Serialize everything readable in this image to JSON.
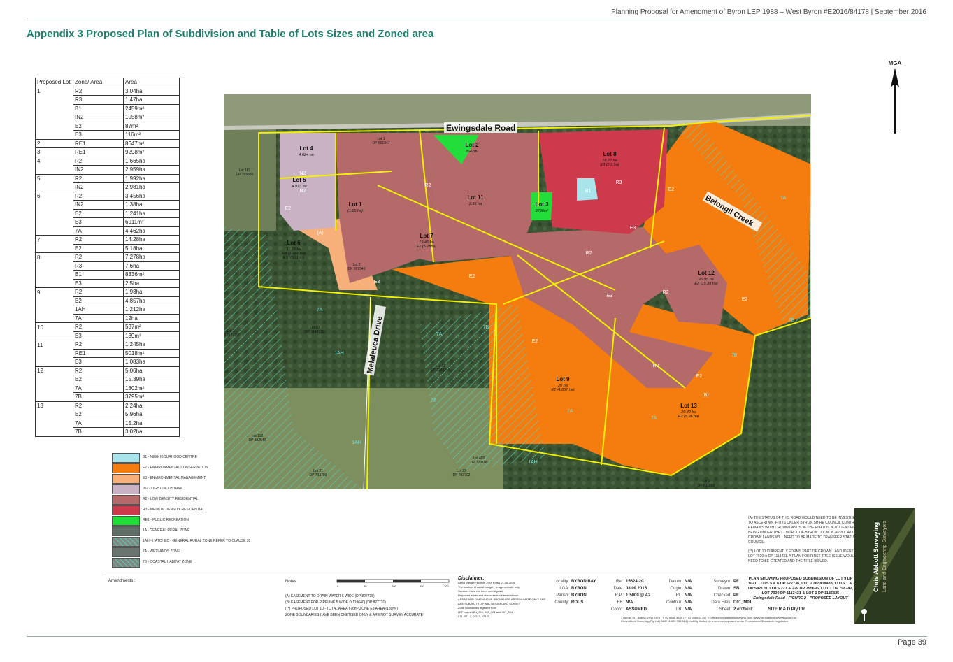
{
  "header": {
    "doc_title": "Planning Proposal for Amendment of Byron LEP 1988 – West Byron #E2016/84178 | September  2016",
    "appendix_title": "Appendix 3 Proposed Plan of Subdivision and Table of Lots Sizes and Zoned area"
  },
  "table": {
    "headers": [
      "Proposed Lot",
      "Zone/ Area",
      "Area"
    ],
    "groups": [
      {
        "lot": "1",
        "rows": [
          [
            "R2",
            "3.04ha"
          ],
          [
            "R3",
            "1.47ha"
          ],
          [
            "B1",
            "2459m²"
          ],
          [
            "IN2",
            "1058m²"
          ],
          [
            "E2",
            "87m²"
          ],
          [
            "E3",
            "116m²"
          ]
        ]
      },
      {
        "lot": "2",
        "rows": [
          [
            "RE1",
            "8647m²"
          ]
        ]
      },
      {
        "lot": "3",
        "rows": [
          [
            "RE1",
            "9298m²"
          ]
        ]
      },
      {
        "lot": "4",
        "rows": [
          [
            "R2",
            "1.665ha"
          ],
          [
            "IN2",
            "2.959ha"
          ]
        ]
      },
      {
        "lot": "5",
        "rows": [
          [
            "R2",
            "1.992ha"
          ],
          [
            "IN2",
            "2.981ha"
          ]
        ]
      },
      {
        "lot": "6",
        "rows": [
          [
            "R2",
            "3.456ha"
          ],
          [
            "IN2",
            "1.38ha"
          ],
          [
            "E2",
            "1.241ha"
          ],
          [
            "E3",
            "6911m²"
          ],
          [
            "7A",
            "4.462ha"
          ]
        ]
      },
      {
        "lot": "7",
        "rows": [
          [
            "R2",
            "14.28ha"
          ],
          [
            "E2",
            "5.18ha"
          ]
        ]
      },
      {
        "lot": "8",
        "rows": [
          [
            "R2",
            "7.278ha"
          ],
          [
            "R3",
            "7.6ha"
          ],
          [
            "B1",
            "8336m²"
          ],
          [
            "E3",
            "2.5ha"
          ]
        ]
      },
      {
        "lot": "9",
        "rows": [
          [
            "R2",
            "1.93ha"
          ],
          [
            "E2",
            "4.857ha"
          ],
          [
            "1AH",
            "1.212ha"
          ],
          [
            "7A",
            "12ha"
          ]
        ]
      },
      {
        "lot": "10",
        "rows": [
          [
            "R2",
            "537m²"
          ],
          [
            "E3",
            "139m²"
          ]
        ]
      },
      {
        "lot": "11",
        "rows": [
          [
            "R2",
            "1.245ha"
          ],
          [
            "RE1",
            "5018m²"
          ],
          [
            "E3",
            "1.083ha"
          ]
        ]
      },
      {
        "lot": "12",
        "rows": [
          [
            "R2",
            "5.06ha"
          ],
          [
            "E2",
            "15.39ha"
          ],
          [
            "7A",
            "1802m²"
          ],
          [
            "7B",
            "3795m²"
          ]
        ]
      },
      {
        "lot": "13",
        "rows": [
          [
            "R2",
            "2.24ha"
          ],
          [
            "E2",
            "5.96ha"
          ],
          [
            "7A",
            "15.2ha"
          ],
          [
            "7B",
            "3.02ha"
          ]
        ]
      }
    ]
  },
  "map": {
    "roads": {
      "ewingsdale": "Ewingsdale Road",
      "melaleuca": "Melaleuca Drive",
      "belongil": "Belongil Creek"
    },
    "north_label": "MGA",
    "colors": {
      "b1": "#a8e4ea",
      "e2": "#f57d10",
      "e3": "#f7b07a",
      "in2": "#c9b2c4",
      "r2": "#b56a6a",
      "r3": "#cc3a4c",
      "re1": "#22dd3a",
      "bush": "#3e5a36",
      "field": "#8a9a68",
      "boundary": "#f3f000"
    },
    "lots": [
      {
        "name": "Lot 4",
        "area": "4.624 ha"
      },
      {
        "name": "Lot 5",
        "area": "4.973 ha"
      },
      {
        "name": "Lot 6",
        "area": "11.23 ha",
        "sub1": "E2 (1.241 ha)",
        "sub2": "E3 (6911m²)"
      },
      {
        "name": "Lot 2",
        "area": "8647m²"
      },
      {
        "name": "Lot 7",
        "area": "19.46 ha",
        "sub1": "E2 (5.18ha)"
      },
      {
        "name": "Lot 3",
        "area": "9298m²"
      },
      {
        "name": "Lot 8",
        "area": "18.27 ha",
        "sub1": "E3 (2.5 ha)"
      },
      {
        "name": "Lot 12",
        "area": "20.95 ha",
        "sub1": "E2 (15.39 ha)"
      },
      {
        "name": "Lot 9",
        "area": "20 ha",
        "sub1": "E2 (4.857 ha)"
      },
      {
        "name": "Lot 13",
        "area": "20.42 ha",
        "sub1": "E2 (5.96 ha)"
      },
      {
        "name": "Lot 1",
        "area": "(1.65 ha)"
      },
      {
        "name": "Lot 11",
        "area": "2.33 ha"
      }
    ],
    "zones": [
      "IN2",
      "IN2",
      "E2",
      "E2",
      "E2",
      "E2",
      "E2",
      "E2",
      "E3",
      "E3",
      "E3",
      "R2",
      "R2",
      "R2",
      "R2",
      "R3",
      "B1",
      "7A",
      "7A",
      "7A",
      "7A",
      "7A",
      "7A",
      "7B",
      "7B",
      "7B",
      "1AH",
      "1AH",
      "1AH",
      "(A)",
      "(B)"
    ],
    "existing_lots": [
      {
        "name": "Lot 181",
        "dp": "DP 755686"
      },
      {
        "name": "Lot 3",
        "dp": "DP 1157282"
      },
      {
        "name": "Lot 10",
        "dp": "DP 1143215"
      },
      {
        "name": "Lot 11",
        "dp": "DP 1143215"
      },
      {
        "name": "Lot 112",
        "dp": "DP 882540"
      },
      {
        "name": "Lot 21",
        "dp": "DP 793702"
      },
      {
        "name": "Lot 22",
        "dp": "DP 793702"
      },
      {
        "name": "Lot 402",
        "dp": "DP 729190"
      },
      {
        "name": "Lot 2",
        "dp": "DP 611050"
      },
      {
        "name": "Lot 1",
        "dp": "DP 661947"
      },
      {
        "name": "Lot 2",
        "dp": "DP 879549"
      }
    ]
  },
  "legend": [
    {
      "label": "B1 - NEIGHBOURHOOD CENTRE",
      "color": "#a8e4ea"
    },
    {
      "label": "E2 - ENVIRONMENTAL CONSERVATION",
      "color": "#f57d10"
    },
    {
      "label": "E3 - ENVIRONMENTAL MANAGEMENT",
      "color": "#f7b07a"
    },
    {
      "label": "IN2 - LIGHT INDUSTRIAL",
      "color": "#c9b2c4"
    },
    {
      "label": "R2 - LOW DENSITY RESIDENTIAL",
      "color": "#b56a6a"
    },
    {
      "label": "R3 - MEDIUM DENSITY RESIDENTIAL",
      "color": "#cc3a4c"
    },
    {
      "label": "RE1 - PUBLIC RECREATION",
      "color": "#22dd3a"
    },
    {
      "label": "1A - GENERAL RURAL ZONE",
      "color": "#607068"
    },
    {
      "label": "1AH - HATCHED - GENERAL RURAL ZONE REFER TO CLAUSE 35",
      "color": "#7f8b83"
    },
    {
      "label": "7A - WETLANDS ZONE",
      "color": "#6a7570"
    },
    {
      "label": "7B - COASTAL HABITAT ZONE",
      "color": "#7e8780"
    }
  ],
  "notes_right": [
    "(A) THE STATUS OF THIS ROAD WOULD NEED TO BE INVESTIGATED TO ASCERTAIN IF IT IS UNDER BYRON SHIRE COUNCIL CONTROL OR REMAINS WITH CROWN LANDS. IF THE ROAD IS NOT IDENTIFIED AS BEING UNDER THE CONTROL OF BYRON COUNCIL APPLICATION TO CROWN LANDS WILL NEED TO BE MADE TO TRANSFER STATUS TO COUNCIL.",
    "(**) LOT 10 CURRENTLY FORMS PART OF CROWN LAND IDENTIFIED IN LOT 7020 in DP 1113431. A PLAN FOR FIRST TITLE ISSUE WOULD NEED TO BE CREATED AND THE TITLE ISSUED."
  ],
  "title_block": {
    "amendments_label": "Amendments :",
    "notes_label": "Notes",
    "notes": [
      "(A) EASEMENT TO DRAIN WATER 5 WIDE (DP 827735)",
      "(B) EASEMENT FOR PIPELINE 5 WIDE (Y119640) (DP 827731)",
      "(**) PROPOSED LOT 10 - TOTAL AREA 676m²  ZONE E3 AREA (139m²)",
      "ZONE BOUNDARIES HAVE BEEN DIGITISED ONLY & ARE NOT SURVEY ACCURATE"
    ],
    "scale_ticks": [
      "0",
      "50",
      "100",
      "150",
      "200"
    ],
    "disclaimer_title": "Disclaimer:",
    "disclaimer": [
      "Aerial imagery source - SIX Portal 21.06.2015",
      "The location of aerial imagery is approximate only",
      "Services have not been investigated",
      "Proposed areas and distances have been shown",
      "AREAS AND DIMENSIONS SHOWN ARE APPROXIMATE ONLY AND ARE SUBJECT TO FINAL DESIGN AND SURVEY",
      "Zone boundaries digitised from",
      "LEP maps LZN_001, 007_001 and 007_004",
      "071, 071-1, 071-2, 071-3"
    ],
    "locality": [
      [
        "Locality:",
        "BYRON BAY"
      ],
      [
        "LGA:",
        "BYRON"
      ],
      [
        "Parish:",
        "BYRON"
      ],
      [
        "County:",
        "ROUS"
      ]
    ],
    "ref": [
      [
        "Ref:",
        "15624-2C"
      ],
      [
        "Date:",
        "08.09.2015"
      ],
      [
        "R.P.:",
        "1:5000 @ A2"
      ],
      [
        "FB:",
        "N/A"
      ],
      [
        "Coord:",
        "ASSUMED"
      ]
    ],
    "datum": [
      [
        "Datum:",
        "N/A"
      ],
      [
        "Origin:",
        "N/A"
      ],
      [
        "RL:",
        "N/A"
      ],
      [
        "Contour:",
        "N/A"
      ],
      [
        "LB:",
        "N/A"
      ]
    ],
    "survey": [
      [
        "Surveyor:",
        "PF"
      ],
      [
        "Drawn:",
        "SB"
      ],
      [
        "Checked:",
        "PF"
      ],
      [
        "Data Files:",
        "D01_M01"
      ],
      [
        "Sheet:",
        "2 of 2"
      ]
    ],
    "plan_title": "PLAN SHOWING PROPOSED SUBDIVISION OF LOT 9 DP 11021, LOTS 5 & 6 DP 622736, LOT 2 DP 818483, LOTS 1 & 2 DP 542170, LOTS 227 & 229 DP 755695, LOT 1 DP 798242, LOT 7020 DP 1113431 & LOT 1 DP 1186325",
    "plan_subtitle": "Ewingsdale Road - FIGURE 2 - PROPOSED LAYOUT",
    "client_label": "Client:",
    "client": "SITE R & D Pty Ltd",
    "contact": "1 Burras St - Ballina NSW 2478 | T: 02 6686 3839 | F: 02 6686 6139 | E: office@chrisabbottsurveying.com | www.chrisabbottsurveying.com.au",
    "contact2": "Chris Abbott Surveying Pty Ltd | ABN 11 122 753 914 | Liability limited by a scheme approved under Professional Standards Legislation"
  },
  "logo": {
    "line1": "Chris Abbott Surveying",
    "line2": "Land and Engineering Surveyors"
  },
  "footer": {
    "page": "Page 39"
  }
}
